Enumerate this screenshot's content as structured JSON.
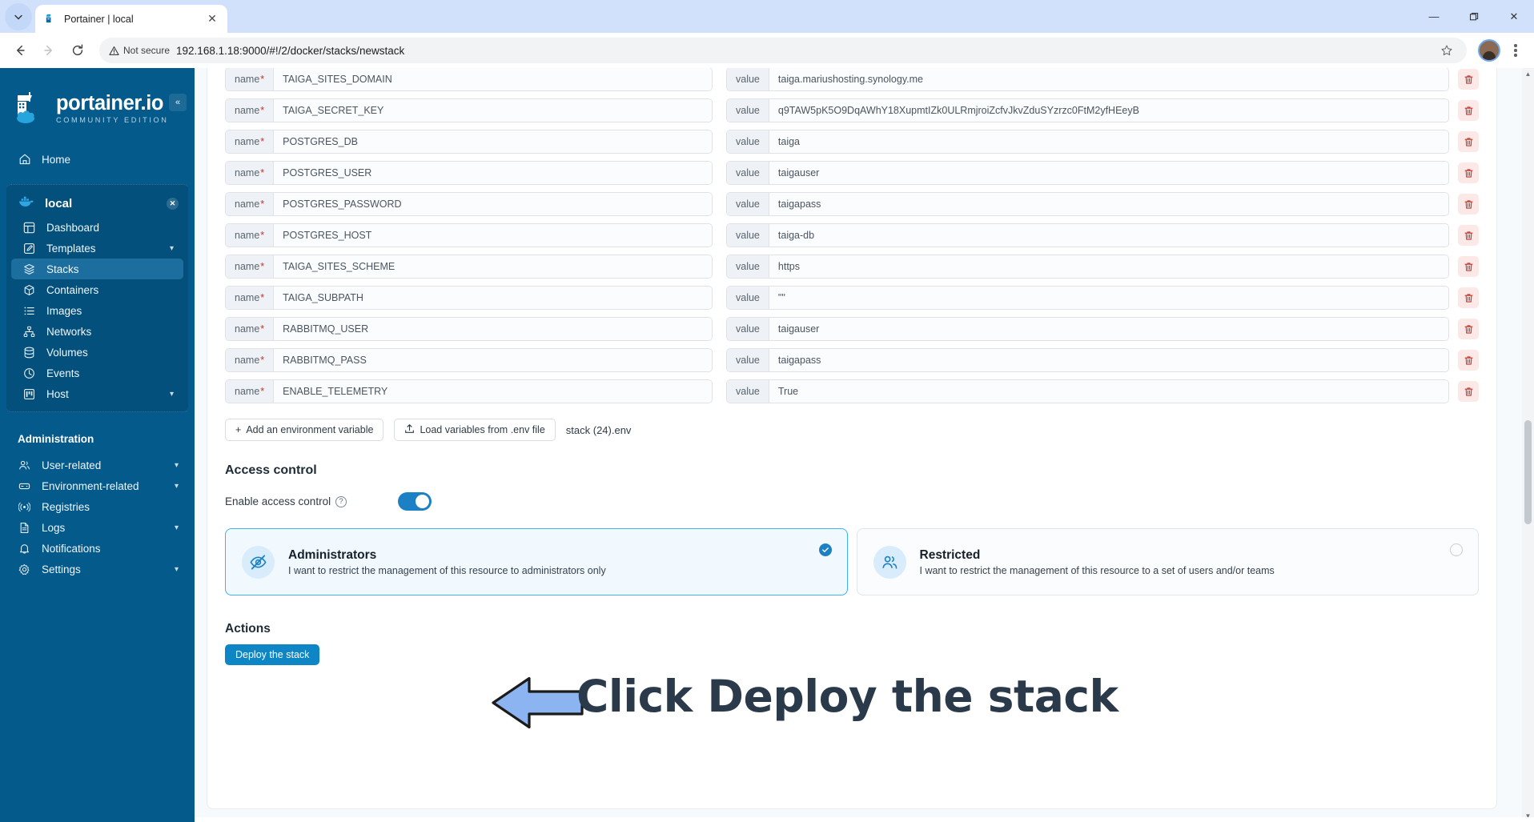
{
  "browser": {
    "tab": {
      "title": "Portainer | local",
      "favicon_icon": "portainer-favicon",
      "close_icon": "close-icon"
    },
    "tab_list_icon": "chevron-down-icon",
    "window_controls": {
      "minimize": "minimize-icon",
      "maximize": "maximize-icon",
      "close": "close-icon"
    },
    "nav": {
      "back_icon": "arrow-left-icon",
      "forward_icon": "arrow-right-icon",
      "reload_icon": "reload-icon"
    },
    "omnibox": {
      "security_label": "Not secure",
      "security_icon": "warning-triangle-icon",
      "url": "192.168.1.18:9000/#!/2/docker/stacks/newstack",
      "bookmark_icon": "star-icon"
    },
    "profile_icon": "avatar",
    "menu_icon": "three-dots-icon"
  },
  "sidebar": {
    "logo": {
      "title": "portainer.io",
      "subtitle": "COMMUNITY EDITION",
      "icon": "portainer-crane-logo"
    },
    "collapse_icon": "double-chevron-left-icon",
    "home": {
      "label": "Home",
      "icon": "home-icon"
    },
    "environment": {
      "name": "local",
      "icon": "docker-whale-icon",
      "close_icon": "close-icon",
      "items": [
        {
          "label": "Dashboard",
          "icon": "dashboard-icon",
          "chevron": "",
          "active": false
        },
        {
          "label": "Templates",
          "icon": "templates-icon",
          "chevron": "⌄",
          "active": false
        },
        {
          "label": "Stacks",
          "icon": "stacks-icon",
          "chevron": "",
          "active": true
        },
        {
          "label": "Containers",
          "icon": "containers-icon",
          "chevron": "",
          "active": false
        },
        {
          "label": "Images",
          "icon": "images-icon",
          "chevron": "",
          "active": false
        },
        {
          "label": "Networks",
          "icon": "networks-icon",
          "chevron": "",
          "active": false
        },
        {
          "label": "Volumes",
          "icon": "volumes-icon",
          "chevron": "",
          "active": false
        },
        {
          "label": "Events",
          "icon": "events-icon",
          "chevron": "",
          "active": false
        },
        {
          "label": "Host",
          "icon": "host-icon",
          "chevron": "⌄",
          "active": false
        }
      ]
    },
    "admin_label": "Administration",
    "admin_items": [
      {
        "label": "User-related",
        "icon": "users-icon",
        "chevron": "⌄"
      },
      {
        "label": "Environment-related",
        "icon": "environment-icon",
        "chevron": "⌄"
      },
      {
        "label": "Registries",
        "icon": "registries-icon",
        "chevron": ""
      },
      {
        "label": "Logs",
        "icon": "logs-icon",
        "chevron": "⌄"
      },
      {
        "label": "Notifications",
        "icon": "bell-icon",
        "chevron": ""
      },
      {
        "label": "Settings",
        "icon": "gear-icon",
        "chevron": "⌄"
      }
    ]
  },
  "env_form": {
    "name_label": "name",
    "value_label": "value",
    "required_mark": "*",
    "delete_icon": "trash-icon",
    "rows": [
      {
        "name": "TAIGA_SITES_DOMAIN",
        "value": "taiga.mariushosting.synology.me"
      },
      {
        "name": "TAIGA_SECRET_KEY",
        "value": "q9TAW5pK5O9DqAWhY18XupmtIZk0ULRmjroiZcfvJkvZduSYzrzc0FtM2yfHEeyB"
      },
      {
        "name": "POSTGRES_DB",
        "value": "taiga"
      },
      {
        "name": "POSTGRES_USER",
        "value": "taigauser"
      },
      {
        "name": "POSTGRES_PASSWORD",
        "value": "taigapass"
      },
      {
        "name": "POSTGRES_HOST",
        "value": "taiga-db"
      },
      {
        "name": "TAIGA_SITES_SCHEME",
        "value": "https"
      },
      {
        "name": "TAIGA_SUBPATH",
        "value": "\"\""
      },
      {
        "name": "RABBITMQ_USER",
        "value": "taigauser"
      },
      {
        "name": "RABBITMQ_PASS",
        "value": "taigapass"
      },
      {
        "name": "ENABLE_TELEMETRY",
        "value": "True"
      }
    ],
    "add_variable_label": "Add an environment variable",
    "add_variable_icon": "plus-icon",
    "load_env_label": "Load variables from .env file",
    "load_env_icon": "upload-icon",
    "loaded_filename": "stack (24).env"
  },
  "access_control": {
    "section_title": "Access control",
    "toggle_label": "Enable access control",
    "help_icon": "question-mark-icon",
    "toggle_on": true,
    "options": [
      {
        "title": "Administrators",
        "description": "I want to restrict the management of this resource to administrators only",
        "icon": "eye-off-icon",
        "selected": true,
        "check_icon": "check-circle-icon"
      },
      {
        "title": "Restricted",
        "description": "I want to restrict the management of this resource to a set of users and/or teams",
        "icon": "users-group-icon",
        "selected": false,
        "check_icon": "radio-empty-icon"
      }
    ]
  },
  "actions": {
    "title": "Actions",
    "deploy_label": "Deploy the stack"
  },
  "annotation": {
    "text": "Click Deploy the stack",
    "arrow_icon": "left-arrow-annotation",
    "arrow_fill": "#8cb4f0",
    "text_color": "#2b3a4a"
  },
  "colors": {
    "sidebar_bg": "#055a8c",
    "accent": "#0e86c6",
    "toggle_on": "#1b81c4",
    "danger": "#c7342c",
    "selected_card_border": "#3db2f0"
  },
  "scrollbar": {
    "up_icon": "chevron-up-icon",
    "down_icon": "chevron-down-icon"
  }
}
